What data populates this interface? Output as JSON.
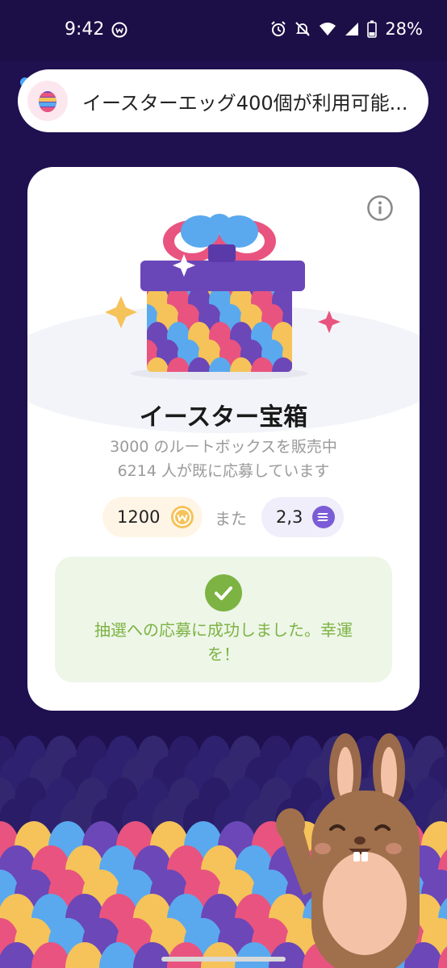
{
  "status_bar": {
    "time": "9:42",
    "battery": "28%",
    "icons": [
      "app-w-icon",
      "alarm-icon",
      "mute-icon",
      "wifi-icon",
      "signal-icon",
      "battery-icon"
    ]
  },
  "notification": {
    "icon": "easter-egg-icon",
    "text": "イースターエッグ400個が利用可能..."
  },
  "card": {
    "title": "イースター宝箱",
    "subtitle_line1": "3000 のルートボックスを販売中",
    "subtitle_line2": "6214 人が既に応募しています",
    "price_coins": "1200",
    "or_label": "また",
    "price_sol": "2,3",
    "success_line1": "抽選への応募に成功しました。幸運",
    "success_line2": "を！"
  },
  "colors": {
    "background": "#1f1050",
    "card": "#ffffff",
    "success_green": "#7cb342",
    "gift_lid": "#6a47b8",
    "egg_pink": "#e8547f",
    "egg_yellow": "#f5c35a",
    "egg_blue": "#5aa9ee",
    "egg_purple": "#6c47b8"
  }
}
